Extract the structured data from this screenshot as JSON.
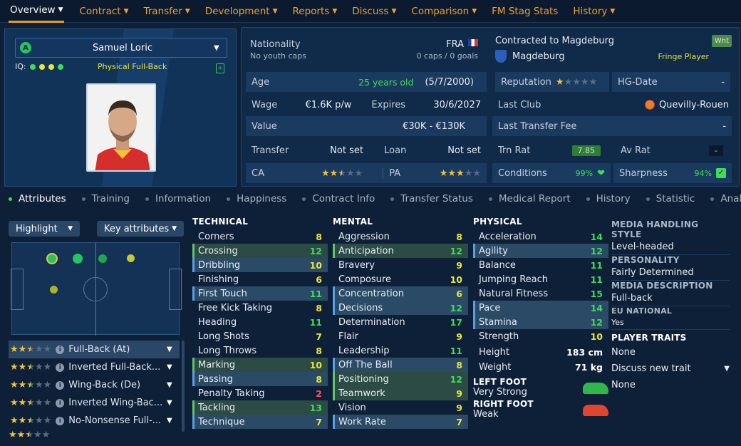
{
  "nav": [
    {
      "label": "Overview",
      "active": true,
      "chev": true
    },
    {
      "label": "Contract",
      "chev": true
    },
    {
      "label": "Transfer",
      "chev": true
    },
    {
      "label": "Development",
      "chev": true
    },
    {
      "label": "Reports",
      "chev": true
    },
    {
      "label": "Discuss",
      "chev": true
    },
    {
      "label": "Comparison",
      "chev": true
    },
    {
      "label": "FM Stag Stats",
      "chev": false
    },
    {
      "label": "History",
      "chev": true
    }
  ],
  "player": {
    "name": "Samuel Loric",
    "role_letter": "A",
    "iq_label": "IQ:",
    "position": "Physical Full-Back"
  },
  "info": {
    "nationality_label": "Nationality",
    "nationality_code": "FRA",
    "youth_caps": "No youth caps",
    "caps": "0 caps / 0 goals",
    "age_label": "Age",
    "age": "25 years old",
    "dob": "(5/7/2000)",
    "wage_label": "Wage",
    "wage": "€1.6K p/w",
    "expires_label": "Expires",
    "expires": "30/6/2027",
    "value_label": "Value",
    "value": "€30K - €130K",
    "transfer_label": "Transfer",
    "transfer": "Not set",
    "loan_label": "Loan",
    "loan": "Not set",
    "ca_label": "CA",
    "ca_stars": 2.5,
    "pa_label": "PA",
    "pa_stars": 3,
    "contracted": "Contracted to Magdeburg",
    "wnt": "Wnt",
    "club": "Magdeburg",
    "squad_status": "Fringe Player",
    "reputation_label": "Reputation",
    "reputation_stars": 1,
    "hg_label": "HG-Date",
    "hg_value": "-",
    "last_club_label": "Last Club",
    "last_club": "Quevilly-Rouen",
    "last_fee_label": "Last Transfer Fee",
    "last_fee": "-",
    "trn_label": "Trn Rat",
    "trn_value": "7.85",
    "av_label": "Av Rat",
    "av_value": "-",
    "conditions_label": "Conditions",
    "conditions": "99%",
    "sharpness_label": "Sharpness",
    "sharpness": "94%"
  },
  "subtabs": [
    "Attributes",
    "Training",
    "Information",
    "Happiness",
    "Contract Info",
    "Transfer Status",
    "Medical Report",
    "History",
    "Statistic",
    "Analysis"
  ],
  "highlight_label": "Highlight",
  "key_attr_label": "Key attributes",
  "roles": [
    {
      "name": "Full-Back (At)",
      "stars": 2.5
    },
    {
      "name": "Inverted Full-Back...",
      "stars": 2.5
    },
    {
      "name": "Wing-Back (De)",
      "stars": 2.5
    },
    {
      "name": "Inverted Wing-Bac...",
      "stars": 2.5
    },
    {
      "name": "No-Nonsense Full-...",
      "stars": 2.5
    }
  ],
  "technical": {
    "title": "TECHNICAL",
    "rows": [
      {
        "n": "Corners",
        "v": "8"
      },
      {
        "n": "Crossing",
        "v": "12",
        "h": "g"
      },
      {
        "n": "Dribbling",
        "v": "10",
        "h": "b"
      },
      {
        "n": "Finishing",
        "v": "6"
      },
      {
        "n": "First Touch",
        "v": "11",
        "h": "b"
      },
      {
        "n": "Free Kick Taking",
        "v": "8"
      },
      {
        "n": "Heading",
        "v": "11"
      },
      {
        "n": "Long Shots",
        "v": "7"
      },
      {
        "n": "Long Throws",
        "v": "8"
      },
      {
        "n": "Marking",
        "v": "10",
        "h": "g"
      },
      {
        "n": "Passing",
        "v": "8",
        "h": "b"
      },
      {
        "n": "Penalty Taking",
        "v": "2"
      },
      {
        "n": "Tackling",
        "v": "13",
        "h": "g"
      },
      {
        "n": "Technique",
        "v": "7",
        "h": "b"
      }
    ]
  },
  "mental": {
    "title": "MENTAL",
    "rows": [
      {
        "n": "Aggression",
        "v": "8"
      },
      {
        "n": "Anticipation",
        "v": "12",
        "h": "g"
      },
      {
        "n": "Bravery",
        "v": "9"
      },
      {
        "n": "Composure",
        "v": "10"
      },
      {
        "n": "Concentration",
        "v": "6",
        "h": "b"
      },
      {
        "n": "Decisions",
        "v": "12",
        "h": "b"
      },
      {
        "n": "Determination",
        "v": "17"
      },
      {
        "n": "Flair",
        "v": "9"
      },
      {
        "n": "Leadership",
        "v": "11"
      },
      {
        "n": "Off The Ball",
        "v": "8",
        "h": "b"
      },
      {
        "n": "Positioning",
        "v": "12",
        "h": "g"
      },
      {
        "n": "Teamwork",
        "v": "9",
        "h": "g"
      },
      {
        "n": "Vision",
        "v": "9"
      },
      {
        "n": "Work Rate",
        "v": "7",
        "h": "b"
      }
    ]
  },
  "physical": {
    "title": "PHYSICAL",
    "rows": [
      {
        "n": "Acceleration",
        "v": "14"
      },
      {
        "n": "Agility",
        "v": "12",
        "h": "b"
      },
      {
        "n": "Balance",
        "v": "11"
      },
      {
        "n": "Jumping Reach",
        "v": "11"
      },
      {
        "n": "Natural Fitness",
        "v": "15"
      },
      {
        "n": "Pace",
        "v": "14",
        "h": "b"
      },
      {
        "n": "Stamina",
        "v": "12",
        "h": "b"
      },
      {
        "n": "Strength",
        "v": "10"
      }
    ],
    "height_label": "Height",
    "height": "183 cm",
    "weight_label": "Weight",
    "weight": "71 kg",
    "left_foot_label": "LEFT FOOT",
    "left_foot": "Very Strong",
    "right_foot_label": "RIGHT FOOT",
    "right_foot": "Weak"
  },
  "media": {
    "style_h": "MEDIA HANDLING STYLE",
    "style": "Level-headed",
    "pers_h": "PERSONALITY",
    "pers": "Fairly Determined",
    "desc_h": "MEDIA DESCRIPTION",
    "desc": "Full-back",
    "eu_h": "EU NATIONAL",
    "eu": "Yes",
    "traits_h": "PLAYER TRAITS",
    "traits": "None",
    "discuss": "Discuss new trait",
    "traits2": "None"
  }
}
